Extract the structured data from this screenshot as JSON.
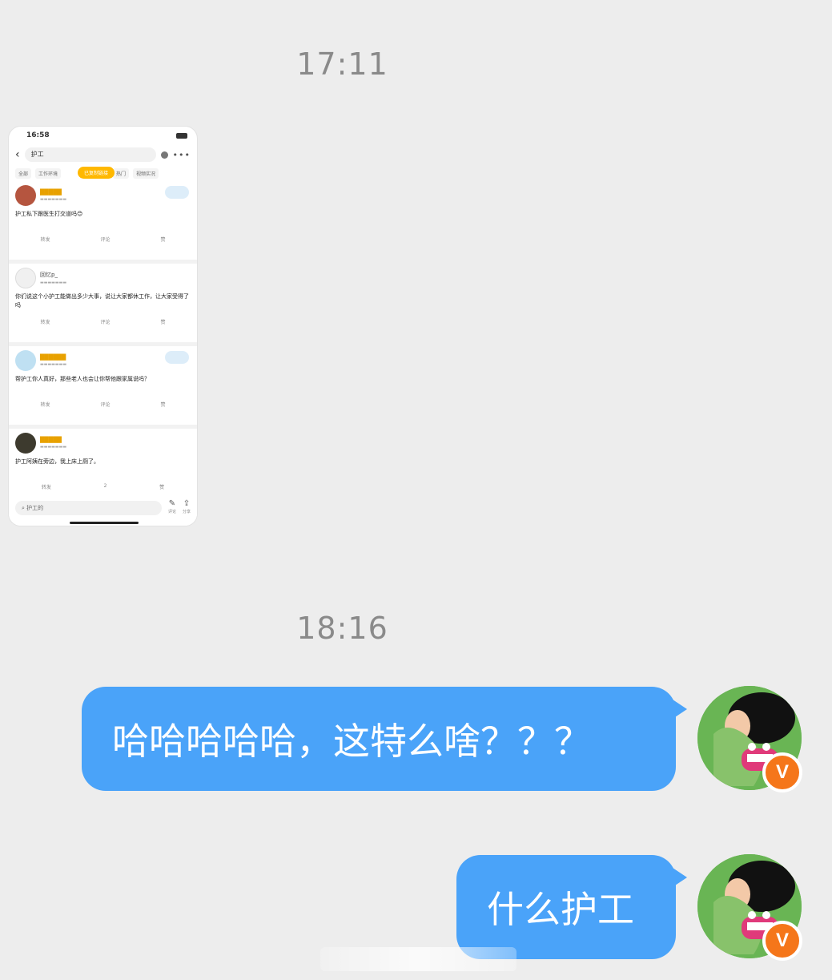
{
  "chat": {
    "timestamp_1": "17:11",
    "timestamp_2": "18:16",
    "messages": [
      {
        "text": "哈哈哈哈哈，这特么啥？？？"
      },
      {
        "text": "什么护工"
      }
    ],
    "bubble_color": "#4aa3f9",
    "background_color": "#ededed",
    "badge_label": "V",
    "badge_color": "#f5761a"
  },
  "screenshot": {
    "status_time": "16:58",
    "search_query": "护工",
    "tabs": [
      "全部",
      "工作环境",
      "热门",
      "视频实况"
    ],
    "toast": "已复制链接",
    "posts": [
      {
        "text": "护工私下跟医生打交道吗😊",
        "actions": [
          "转发",
          "评论",
          "赞"
        ]
      },
      {
        "name": "回忆p_",
        "text": "你们说这个小护工能做出多少大事，说让大家都休工作，让大家受得了吗",
        "actions": [
          "转发",
          "评论",
          "赞"
        ]
      },
      {
        "text": "帮护工你人真好，那些老人也会让你帮他跟家属说吗？",
        "actions": [
          "转发",
          "评论",
          "赞"
        ]
      },
      {
        "text": "护工阿姨在旁边，我上床上厕了。",
        "actions": [
          "转发",
          "2",
          "赞"
        ]
      }
    ],
    "bottom_search": "护工的",
    "bottom_icons": [
      "评论",
      "分享"
    ]
  }
}
